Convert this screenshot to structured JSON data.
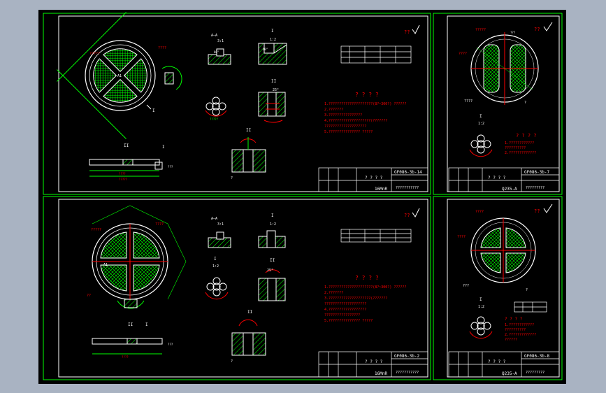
{
  "colors": {
    "outer_bg": "#a9b3c2",
    "sheet_bg": "#000000",
    "frame": "#00ff00",
    "geometry": "#ffffff",
    "hatch": "#00ff00",
    "dimension": "#00ff00",
    "annotation": "#ff0000",
    "title_text": "#ffffff"
  },
  "sheets": [
    {
      "id": "top-left",
      "drawing_no": "GF086-3b-14",
      "material": "16MnR",
      "title_zh": "? ? ? ?",
      "notes_title": "? ? ? ?",
      "notes": [
        "1.?????????????????????(8?~300?)      ??????",
        "2.???????",
        "3.????????????????",
        "4.????????????????????(???????",
        "   ????????????????????",
        "5.??????????????? ?????"
      ],
      "section_labels": [
        "A-A",
        "I",
        "II"
      ],
      "roughness": "??"
    },
    {
      "id": "top-right",
      "drawing_no": "GF086-3b-7",
      "material": "Q235-A",
      "title_zh": "? ? ? ?",
      "notes_title": "? ? ? ?",
      "notes": [
        "1.????????????",
        "   ??????????",
        "2.?????????????"
      ],
      "section_labels": [
        "I"
      ],
      "roughness": "??"
    },
    {
      "id": "bottom-left",
      "drawing_no": "GF086-3b-2",
      "material": "16MnR",
      "title_zh": "? ? ? ?",
      "notes_title": "? ? ? ?",
      "notes": [
        "1.?????????????????????(8?~300?)      ??????",
        "2.???????",
        "3.????????????????????(???????",
        "   ????????????????????",
        "4.??????????????????",
        "   ?????????????????",
        "5.??????????????? ?????"
      ],
      "section_labels": [
        "A-A",
        "I",
        "II"
      ],
      "roughness": "??"
    },
    {
      "id": "bottom-right",
      "drawing_no": "GF086-3b-8",
      "material": "Q235-A",
      "title_zh": "? ? ? ?",
      "notes_title": "? ? ? ?",
      "notes": [
        "1.????????????",
        "   ??????????",
        "2.?????????????",
        "   ??????"
      ],
      "section_labels": [
        "I"
      ],
      "roughness": "??"
    }
  ]
}
